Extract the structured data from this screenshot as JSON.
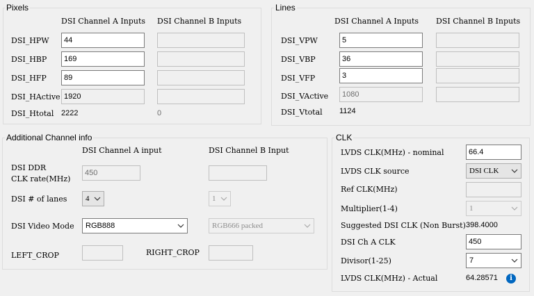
{
  "pixels": {
    "title": "Pixels",
    "col_a": "DSI Channel A Inputs",
    "col_b": "DSI Channel B Inputs",
    "rows": [
      {
        "label": "DSI_HPW",
        "a": "44"
      },
      {
        "label": "DSI_HBP",
        "a": "169"
      },
      {
        "label": "DSI_HFP",
        "a": "89"
      },
      {
        "label": "DSI_HActive",
        "a": "1920"
      }
    ],
    "total_label": "DSI_Htotal",
    "total_a": "2222",
    "total_b": "0"
  },
  "lines": {
    "title": "Lines",
    "col_a": "DSI Channel A Inputs",
    "col_b": "DSI Channel B Inputs",
    "rows": [
      {
        "label": "DSI_VPW",
        "a": "5"
      },
      {
        "label": "DSI_VBP",
        "a": "36"
      },
      {
        "label": "DSI_VFP",
        "a": "3"
      },
      {
        "label": "DSI_VActive",
        "a": "1080"
      }
    ],
    "total_label": "DSI_Vtotal",
    "total_a": "1124"
  },
  "additional": {
    "title": "Additional Channel info",
    "col_a": "DSI Channel A input",
    "col_b": "DSI Channel B Input",
    "ddr_label_1": "DSI DDR",
    "ddr_label_2": "CLK rate(MHz)",
    "ddr_a": "450",
    "lanes_label": "DSI # of lanes",
    "lanes_a": "4",
    "lanes_b": "1",
    "mode_label": "DSI Video Mode",
    "mode_a": "RGB888",
    "mode_b": "RGB666 packed",
    "left_crop_label": "LEFT_CROP",
    "right_crop_label": "RIGHT_CROP"
  },
  "clk": {
    "title": "CLK",
    "nominal_label": "LVDS CLK(MHz) - nominal",
    "nominal_value": "66.4",
    "source_label": "LVDS CLK source",
    "source_value": "DSI CLK",
    "refclk_label": "Ref CLK(MHz)",
    "multiplier_label": "Multiplier(1-4)",
    "multiplier_value": "1",
    "suggested_label": "Suggested DSI CLK (Non Burst)",
    "suggested_value": "398.4000",
    "cha_label": "DSI Ch A CLK",
    "cha_value": "450",
    "divisor_label": "Divisor(1-25)",
    "divisor_value": "7",
    "actual_label": "LVDS CLK(MHz) - Actual",
    "actual_value": "64.28571",
    "info_glyph": "i"
  }
}
